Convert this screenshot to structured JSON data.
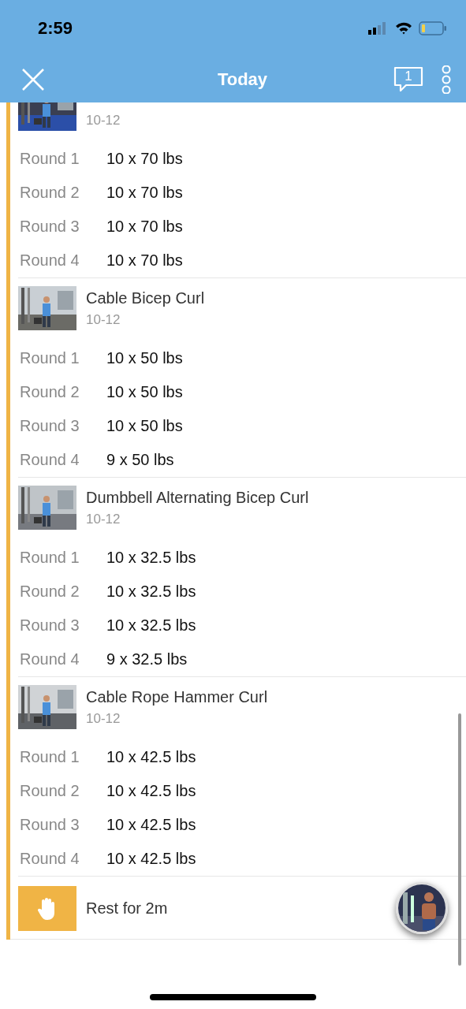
{
  "status_bar": {
    "time": "2:59"
  },
  "nav": {
    "title": "Today",
    "message_count": "1"
  },
  "exercises": [
    {
      "reps": "10-12",
      "rounds": [
        {
          "label": "Round 1",
          "value": "10 x 70 lbs"
        },
        {
          "label": "Round 2",
          "value": "10 x 70 lbs"
        },
        {
          "label": "Round 3",
          "value": "10 x 70 lbs"
        },
        {
          "label": "Round 4",
          "value": "10 x 70 lbs"
        }
      ]
    },
    {
      "name": "Cable Bicep Curl",
      "reps": "10-12",
      "rounds": [
        {
          "label": "Round 1",
          "value": "10 x 50 lbs"
        },
        {
          "label": "Round 2",
          "value": "10 x 50 lbs"
        },
        {
          "label": "Round 3",
          "value": "10 x 50 lbs"
        },
        {
          "label": "Round 4",
          "value": "9 x 50 lbs"
        }
      ]
    },
    {
      "name": "Dumbbell Alternating Bicep Curl",
      "reps": "10-12",
      "rounds": [
        {
          "label": "Round 1",
          "value": "10 x 32.5 lbs"
        },
        {
          "label": "Round 2",
          "value": "10 x 32.5 lbs"
        },
        {
          "label": "Round 3",
          "value": "10 x 32.5 lbs"
        },
        {
          "label": "Round 4",
          "value": "9 x 32.5 lbs"
        }
      ]
    },
    {
      "name": "Cable Rope Hammer Curl",
      "reps": "10-12",
      "rounds": [
        {
          "label": "Round 1",
          "value": "10 x 42.5 lbs"
        },
        {
          "label": "Round 2",
          "value": "10 x 42.5 lbs"
        },
        {
          "label": "Round 3",
          "value": "10 x 42.5 lbs"
        },
        {
          "label": "Round 4",
          "value": "10 x 42.5 lbs"
        }
      ]
    }
  ],
  "rest": {
    "label": "Rest for 2m"
  }
}
